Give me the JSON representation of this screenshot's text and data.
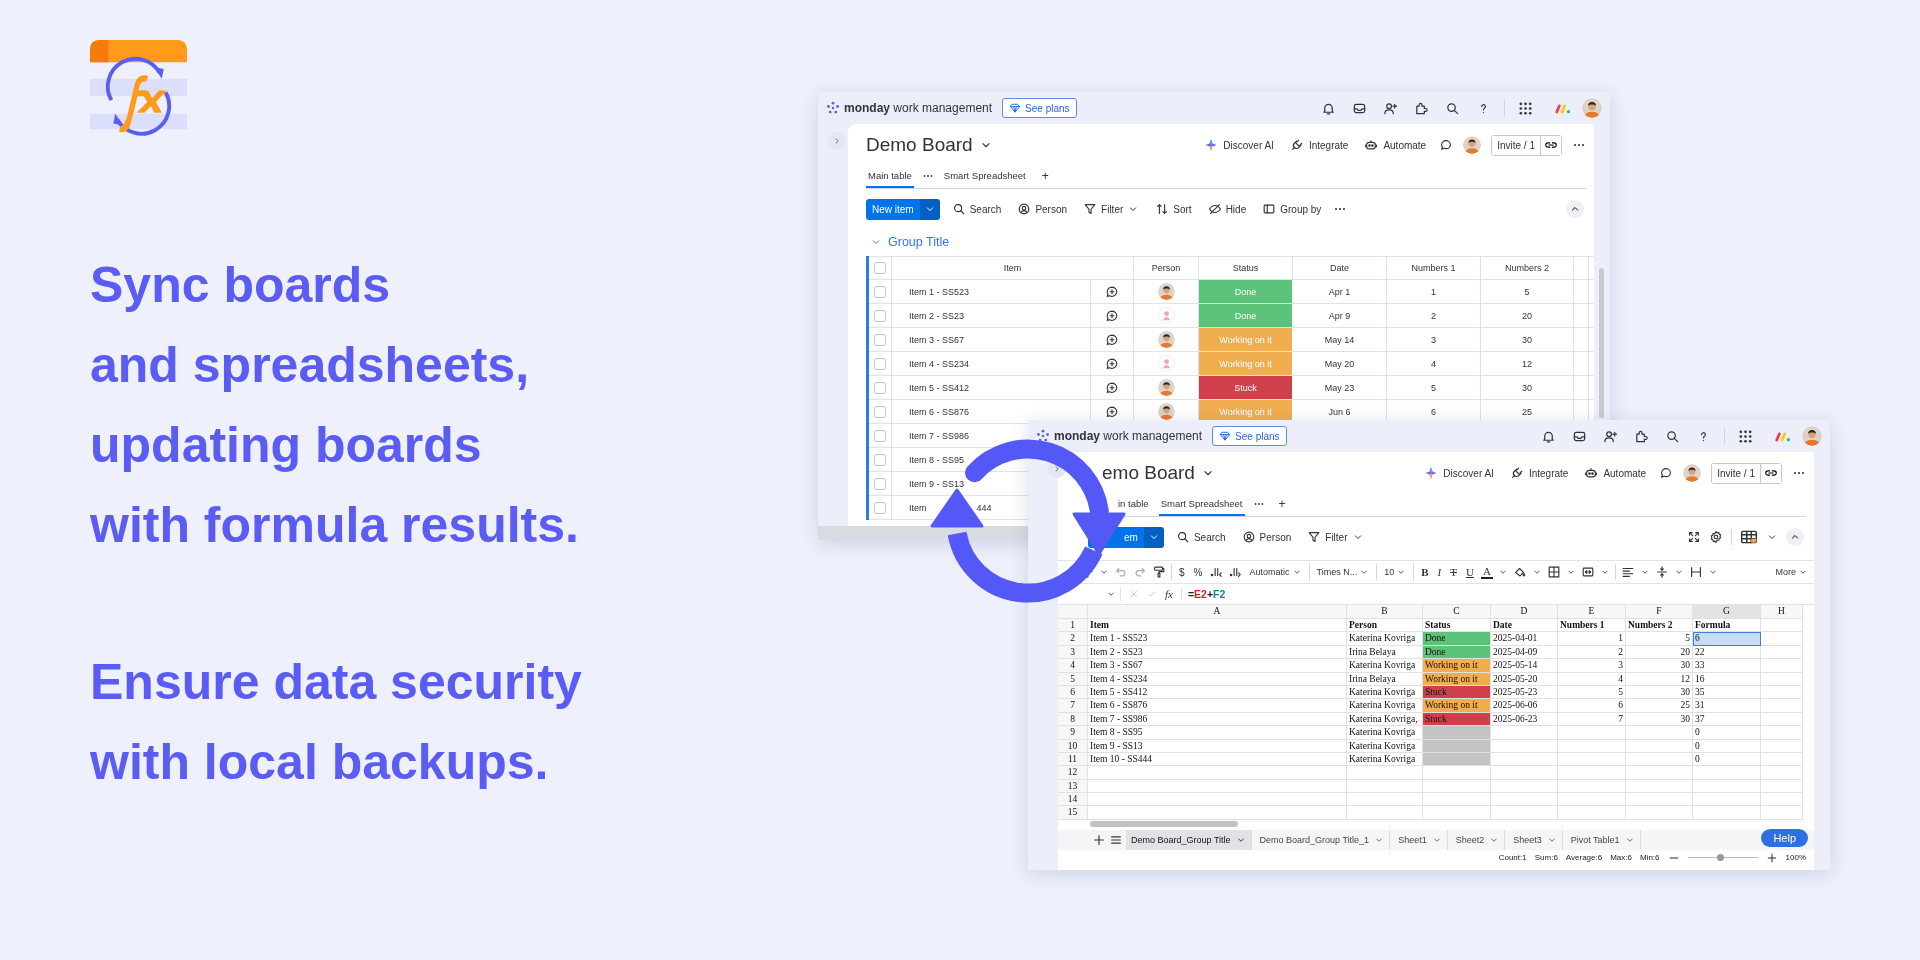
{
  "left": {
    "paragraphs": [
      {
        "lines": [
          "Sync boards",
          "and spreadsheets,",
          "updating boards",
          "with formula results."
        ]
      },
      {
        "lines": [
          "Ensure data security",
          "with local backups."
        ]
      }
    ]
  },
  "windows": [
    {
      "kind": "board",
      "app": {
        "brand": "monday",
        "product": "work management",
        "plans": "See plans"
      },
      "title": "Demo Board",
      "actions": [
        "Discover AI",
        "Integrate",
        "Automate"
      ],
      "invite": "Invite / 1",
      "tabs": [
        {
          "label": "Main table",
          "selected": true
        },
        {
          "label": "Smart Spreadsheet",
          "selected": false
        }
      ],
      "add_tab": "+",
      "new_item": "New item",
      "tools": [
        {
          "kind": "search",
          "label": "Search",
          "dropdown": false
        },
        {
          "kind": "person",
          "label": "Person",
          "dropdown": false
        },
        {
          "kind": "filter",
          "label": "Filter",
          "dropdown": true
        },
        {
          "kind": "sort",
          "label": "Sort",
          "dropdown": false
        },
        {
          "kind": "hide",
          "label": "Hide",
          "dropdown": false
        },
        {
          "kind": "group",
          "label": "Group by",
          "dropdown": false
        }
      ],
      "group_title": "Group Title",
      "select_all": {
        "checked": false
      },
      "columns": [
        "Item",
        "Person",
        "Status",
        "Date",
        "Numbers 1",
        "Numbers 2"
      ],
      "rows": [
        {
          "item": "Item 1 - SS523",
          "checked": false,
          "kind": "photo",
          "status": "Done",
          "color": "#5cc37b",
          "date": "Apr 1",
          "n1": "1",
          "n2": "5"
        },
        {
          "item": "Item 2 - SS23",
          "checked": false,
          "kind": "drawing",
          "status": "Done",
          "color": "#5cc37b",
          "date": "Apr 9",
          "n1": "2",
          "n2": "20"
        },
        {
          "item": "Item 3 - SS67",
          "checked": false,
          "kind": "photo",
          "status": "Working on it",
          "color": "#f1ae50",
          "date": "May 14",
          "n1": "3",
          "n2": "30"
        },
        {
          "item": "Item 4 - SS234",
          "checked": false,
          "kind": "drawing",
          "status": "Working on it",
          "color": "#f1ae50",
          "date": "May 20",
          "n1": "4",
          "n2": "12"
        },
        {
          "item": "Item 5 - SS412",
          "checked": false,
          "kind": "photo",
          "status": "Stuck",
          "color": "#d0404c",
          "date": "May 23",
          "n1": "5",
          "n2": "30"
        },
        {
          "item": "Item 6 - SS876",
          "checked": false,
          "kind": "photo",
          "status": "Working on it",
          "color": "#f1ae50",
          "date": "Jun 6",
          "n1": "6",
          "n2": "25"
        },
        {
          "item": "Item 7 - SS986",
          "checked": false
        },
        {
          "item": "Item 8 - SS95",
          "checked": false
        },
        {
          "item": "Item 9 - SS13",
          "checked": false
        },
        {
          "item": "Item",
          "item_end": "444",
          "checked": false
        }
      ]
    },
    {
      "kind": "spreadsheet",
      "app": {
        "brand": "monday",
        "product": "work management",
        "plans": "See plans"
      },
      "title": "emo Board",
      "actions": [
        "Discover AI",
        "Integrate",
        "Automate"
      ],
      "invite": "Invite / 1",
      "tabs": [
        {
          "label": "in table",
          "selected": false
        },
        {
          "label": "Smart Spreadsheet",
          "selected": true
        }
      ],
      "add_tab": "+",
      "new_item": "em",
      "tools": [
        {
          "kind": "search",
          "label": "Search",
          "dropdown": false
        },
        {
          "kind": "person",
          "label": "Person",
          "dropdown": false
        },
        {
          "kind": "filter",
          "label": "Filter",
          "dropdown": true
        }
      ],
      "format_toolbar": {
        "glyphs": [
          "$",
          "%"
        ],
        "number_format": "Automatic",
        "font": "Times N...",
        "size": "10",
        "styles": [
          "B",
          "I",
          "T",
          "U",
          "A"
        ],
        "more": "More"
      },
      "formula": {
        "fx": "fx",
        "parts": [
          {
            "text": "=",
            "color": "#222222"
          },
          {
            "text": "E2",
            "color": "#c0282d"
          },
          {
            "text": "+",
            "color": "#222222"
          },
          {
            "text": "F2",
            "color": "#17808c"
          }
        ]
      },
      "columns": [
        {
          "letter": "A",
          "selected": false
        },
        {
          "letter": "B",
          "selected": false
        },
        {
          "letter": "C",
          "selected": false
        },
        {
          "letter": "D",
          "selected": false
        },
        {
          "letter": "E",
          "selected": false
        },
        {
          "letter": "F",
          "selected": false
        },
        {
          "letter": "G",
          "selected": true
        },
        {
          "letter": "H",
          "selected": false
        }
      ],
      "row_numbers": [
        "1",
        "2",
        "3",
        "4",
        "5",
        "6",
        "7",
        "8",
        "9",
        "10",
        "11",
        "12",
        "13",
        "14",
        "15"
      ],
      "header": [
        "Item",
        "Person",
        "Status",
        "Date",
        "Numbers 1",
        "Numbers 2",
        "Formula"
      ],
      "rows": [
        {
          "item": "Item 1 - SS523",
          "person": "Katerina Kovriga",
          "status": "Done",
          "color": "#5cc37b",
          "date": "2025-04-01",
          "n1": "1",
          "n2": "5",
          "formula": "6",
          "selected": true
        },
        {
          "item": "Item 2 - SS23",
          "person": "Irina Belaya",
          "status": "Done",
          "color": "#5cc37b",
          "date": "2025-04-09",
          "n1": "2",
          "n2": "20",
          "formula": "22",
          "selected": false
        },
        {
          "item": "Item 3 - SS67",
          "person": "Katerina Kovriga",
          "status": "Working on it",
          "color": "#f1ae50",
          "date": "2025-05-14",
          "n1": "3",
          "n2": "30",
          "formula": "33",
          "selected": false
        },
        {
          "item": "Item 4 - SS234",
          "person": "Irina Belaya",
          "status": "Working on it",
          "color": "#f1ae50",
          "date": "2025-05-20",
          "n1": "4",
          "n2": "12",
          "formula": "16",
          "selected": false
        },
        {
          "item": "Item 5 - SS412",
          "person": "Katerina Kovriga",
          "status": "Stuck",
          "color": "#d0404c",
          "date": "2025-05-23",
          "n1": "5",
          "n2": "30",
          "formula": "35",
          "selected": false
        },
        {
          "item": "Item 6 - SS876",
          "person": "Katerina Kovriga",
          "status": "Working on it",
          "color": "#f1ae50",
          "date": "2025-06-06",
          "n1": "6",
          "n2": "25",
          "formula": "31",
          "selected": false
        },
        {
          "item": "Item 7 - SS986",
          "person": "Katerina Kovriga,",
          "status": "Stuck",
          "color": "#d0404c",
          "date": "2025-06-23",
          "n1": "7",
          "n2": "30",
          "formula": "37",
          "selected": false
        },
        {
          "item": "Item 8 - SS95",
          "person": "Katerina Kovriga",
          "color": "#c4c4c4",
          "formula": "0",
          "selected": false
        },
        {
          "item": "Item 9 - SS13",
          "person": "Katerina Kovriga",
          "color": "#c4c4c4",
          "formula": "0",
          "selected": false
        },
        {
          "item": "Item 10 - SS444",
          "person": "Katerina Kovriga",
          "color": "#c4c4c4",
          "formula": "0",
          "selected": false
        }
      ],
      "sheets": [
        {
          "label": "Demo Board_Group Title",
          "selected": true
        },
        {
          "label": "Demo Board_Group Title_1",
          "selected": false
        },
        {
          "label": "Sheet1",
          "selected": false
        },
        {
          "label": "Sheet2",
          "selected": false
        },
        {
          "label": "Sheet3",
          "selected": false
        },
        {
          "label": "Pivot Table1",
          "selected": false
        }
      ],
      "help": "Help",
      "stats": [
        "Count:1",
        "Sum:6",
        "Average:6",
        "Max:6",
        "Min:6"
      ],
      "zoom": {
        "level": 0.47,
        "reading": "100%"
      }
    }
  ]
}
